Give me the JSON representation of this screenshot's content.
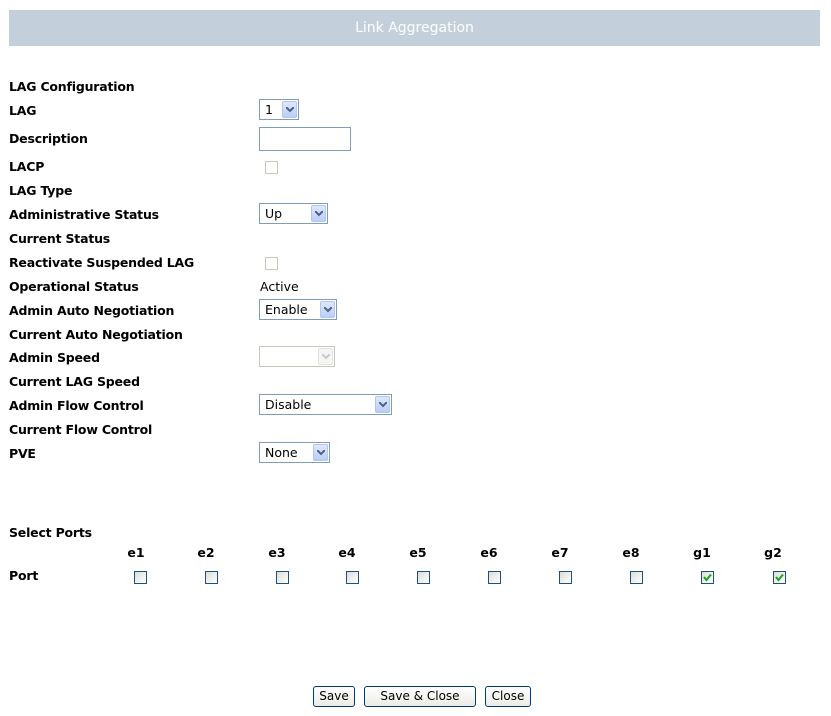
{
  "header": {
    "title": "Link Aggregation"
  },
  "section_title": "LAG Configuration",
  "fields": {
    "lag": {
      "label": "LAG",
      "value": "1"
    },
    "description": {
      "label": "Description",
      "value": ""
    },
    "lacp": {
      "label": "LACP",
      "checked": false,
      "disabled": true
    },
    "lag_type": {
      "label": "LAG Type",
      "value": ""
    },
    "admin_status": {
      "label": "Administrative Status",
      "value": "Up"
    },
    "current_status": {
      "label": "Current Status",
      "value": ""
    },
    "reactivate": {
      "label": "Reactivate Suspended LAG",
      "checked": false,
      "disabled": true
    },
    "operational_status": {
      "label": "Operational Status",
      "value": "Active"
    },
    "admin_auto_neg": {
      "label": "Admin Auto Negotiation",
      "value": "Enable"
    },
    "current_auto_neg": {
      "label": "Current Auto Negotiation",
      "value": ""
    },
    "admin_speed": {
      "label": "Admin Speed",
      "value": "",
      "disabled": true
    },
    "current_lag_speed": {
      "label": "Current LAG Speed",
      "value": ""
    },
    "admin_flow_control": {
      "label": "Admin Flow Control",
      "value": "Disable"
    },
    "current_flow_control": {
      "label": "Current Flow Control",
      "value": ""
    },
    "pve": {
      "label": "PVE",
      "value": "None"
    }
  },
  "ports": {
    "title": "Select Ports",
    "row_label": "Port",
    "columns": [
      "e1",
      "e2",
      "e3",
      "e4",
      "e5",
      "e6",
      "e7",
      "e8",
      "g1",
      "g2"
    ],
    "checked": [
      false,
      false,
      false,
      false,
      false,
      false,
      false,
      false,
      true,
      true
    ]
  },
  "buttons": {
    "save": "Save",
    "save_close": "Save & Close",
    "close": "Close"
  },
  "colors": {
    "header_bg": "#c3d0dc",
    "check": "#21a121"
  }
}
